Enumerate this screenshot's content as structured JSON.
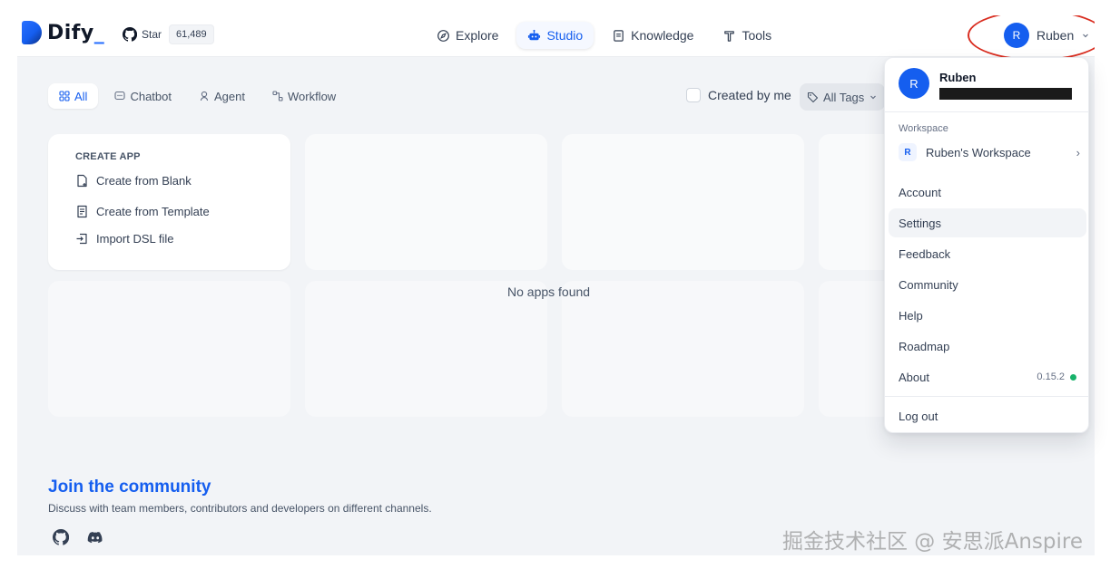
{
  "brand": {
    "name": "Dify",
    "suffix": "_"
  },
  "github": {
    "star_label": "Star",
    "star_count": "61,489"
  },
  "nav": {
    "items": [
      {
        "label": "Explore",
        "icon": "compass-icon"
      },
      {
        "label": "Studio",
        "icon": "robot-icon",
        "active": true
      },
      {
        "label": "Knowledge",
        "icon": "book-icon"
      },
      {
        "label": "Tools",
        "icon": "tool-icon"
      }
    ]
  },
  "user": {
    "initial": "R",
    "name": "Ruben"
  },
  "tabs": [
    {
      "label": "All",
      "active": true
    },
    {
      "label": "Chatbot"
    },
    {
      "label": "Agent"
    },
    {
      "label": "Workflow"
    }
  ],
  "filters": {
    "created_by_me": "Created by me",
    "all_tags": "All Tags"
  },
  "create_card": {
    "title": "CREATE APP",
    "items": [
      "Create from Blank",
      "Create from Template",
      "Import DSL file"
    ]
  },
  "empty_message": "No apps found",
  "community": {
    "title": "Join the community",
    "description": "Discuss with team members, contributors and developers on different channels."
  },
  "dropdown": {
    "name": "Ruben",
    "initial": "R",
    "workspace_label": "Workspace",
    "workspace_initial": "R",
    "workspace_name": "Ruben's Workspace",
    "items": [
      "Account",
      "Settings",
      "Feedback",
      "Community",
      "Help",
      "Roadmap",
      "About"
    ],
    "version": "0.15.2",
    "logout": "Log out"
  },
  "watermark": "掘金技术社区 @ 安思派Anspire",
  "colors": {
    "accent": "#155eef",
    "status_ok": "#17b26a",
    "highlight_ring": "#d92d20"
  }
}
